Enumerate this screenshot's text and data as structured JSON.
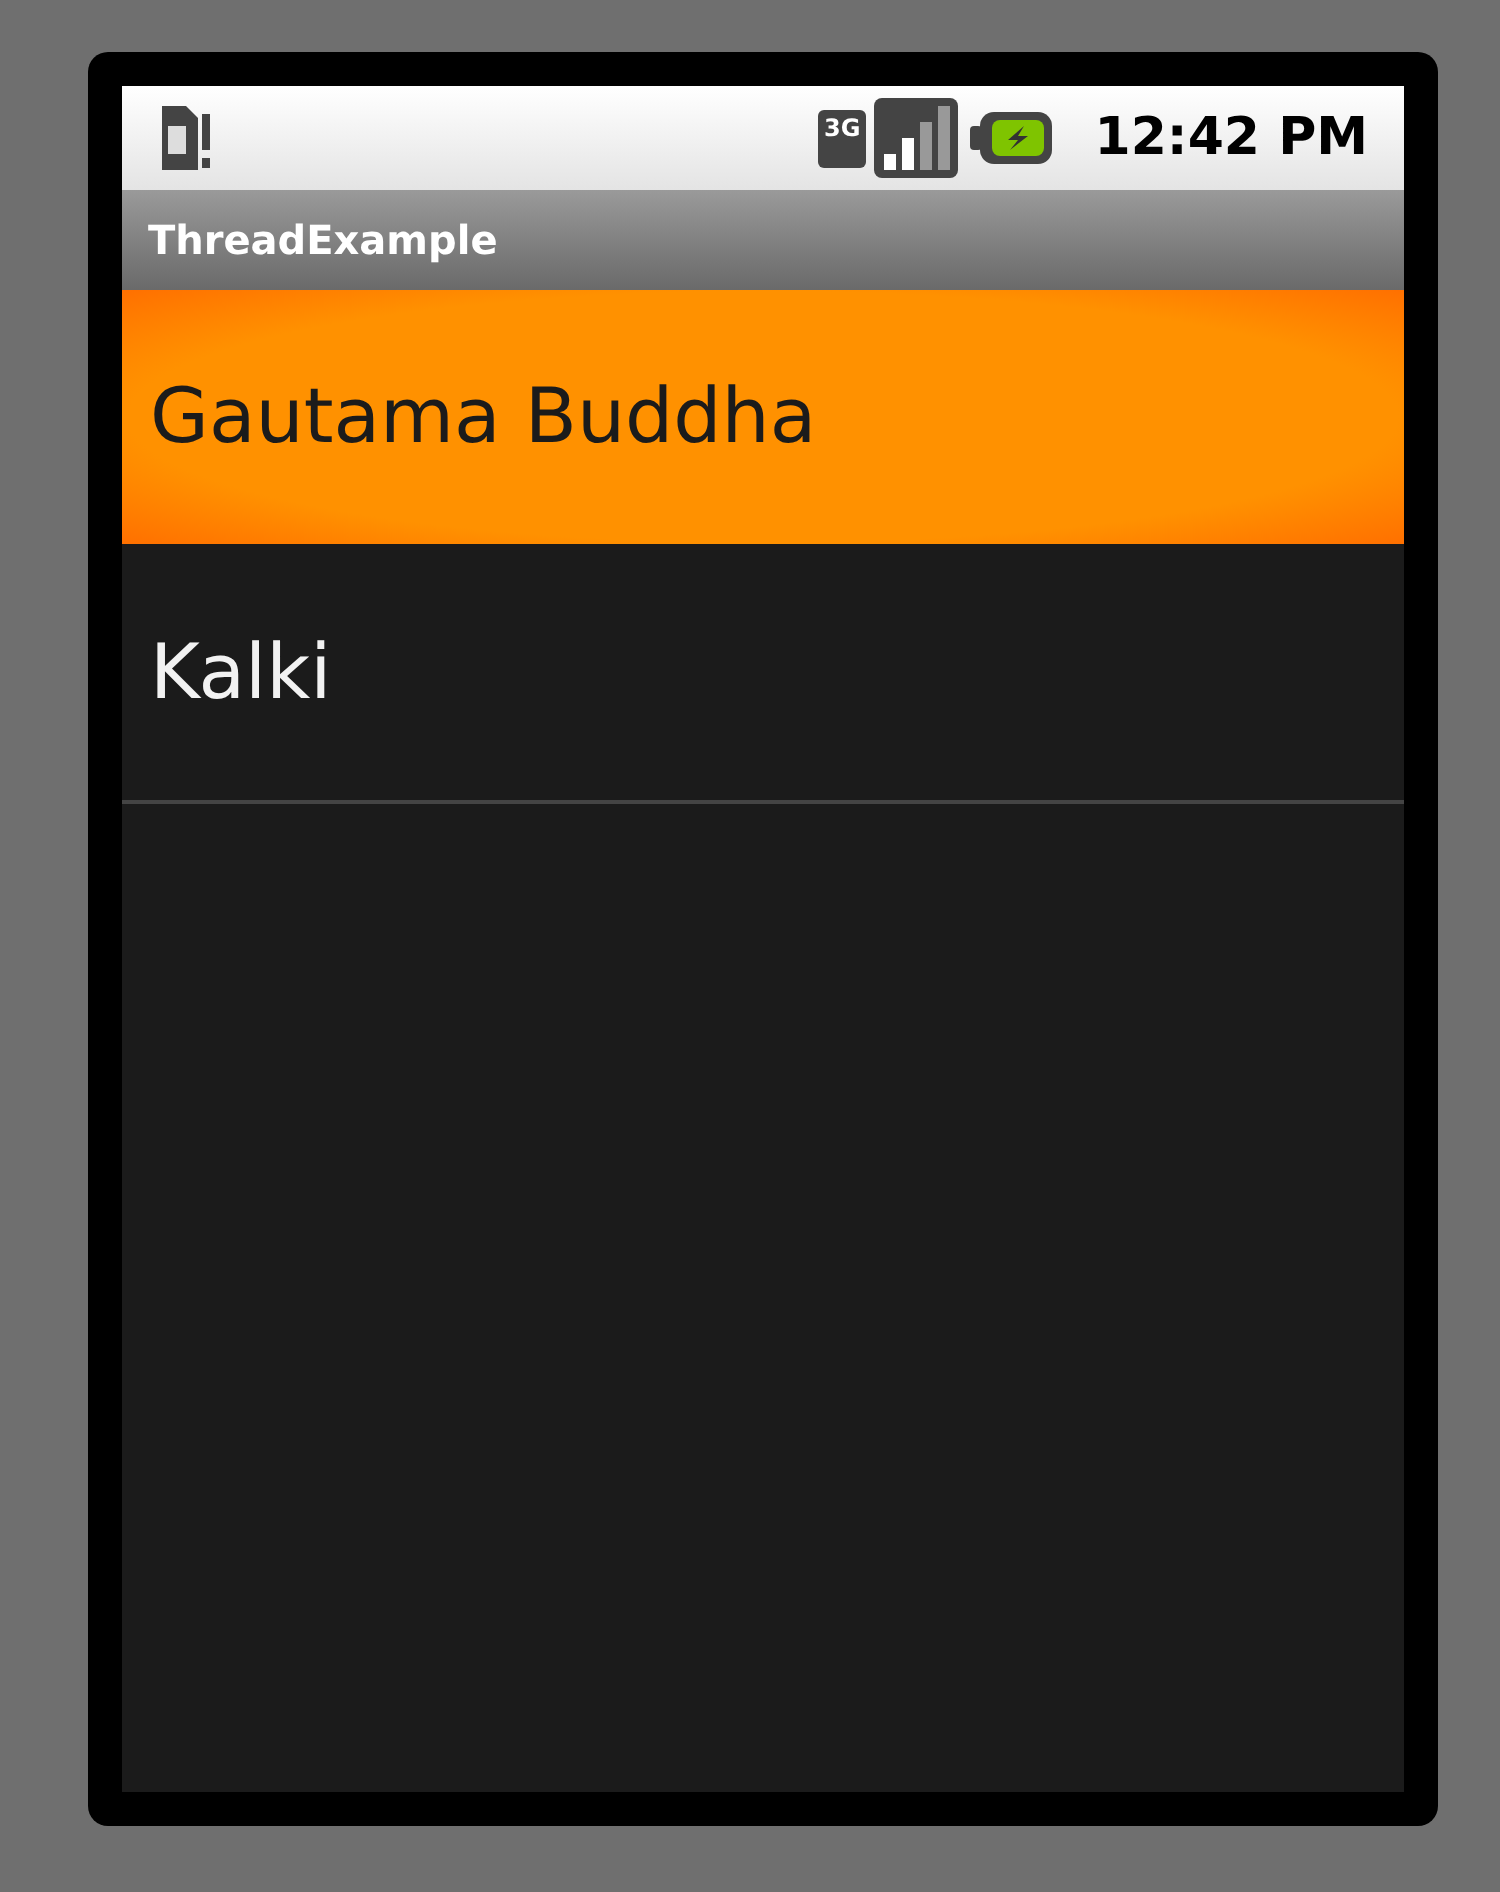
{
  "status_bar": {
    "network_type": "3G",
    "time": "12:42 PM"
  },
  "app_bar": {
    "title": "ThreadExample"
  },
  "list": [
    {
      "label": "Gautama Buddha",
      "selected": true
    },
    {
      "label": "Kalki",
      "selected": false
    }
  ]
}
